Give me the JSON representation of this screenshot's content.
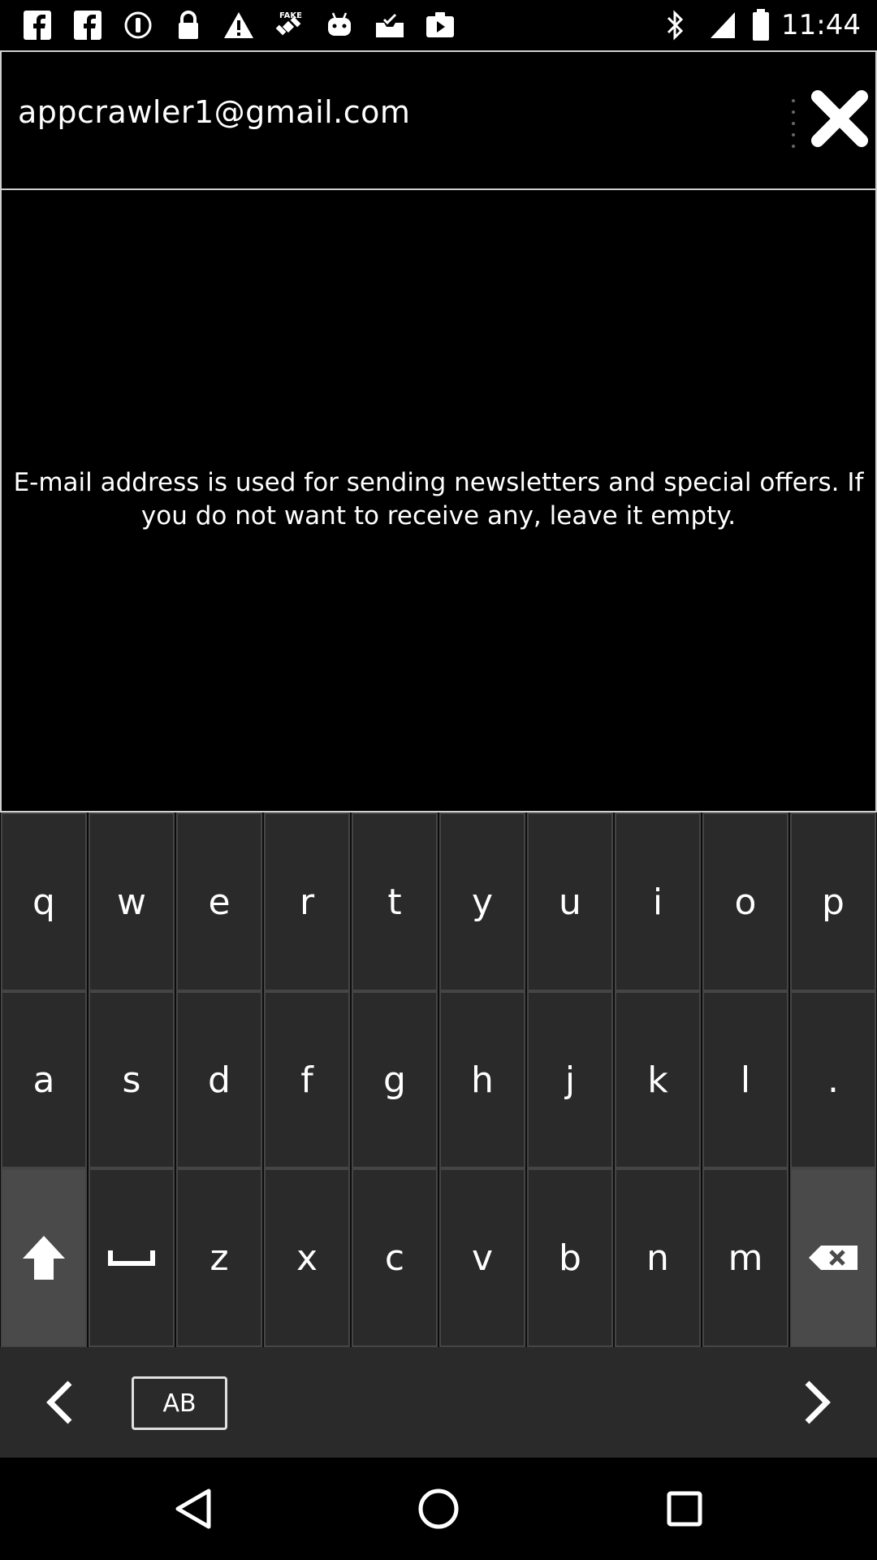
{
  "status_bar": {
    "time": "11:44",
    "left_icons": [
      "facebook-icon",
      "facebook-icon",
      "info-icon",
      "lock-icon",
      "warning-icon",
      "fake-gps-icon",
      "android-icon",
      "inbox-icon",
      "video-icon"
    ],
    "right_icons": [
      "bluetooth-icon",
      "signal-icon",
      "battery-icon"
    ]
  },
  "email": {
    "value": "appcrawler1@gmail.com"
  },
  "info": {
    "message": "E-mail address is used for sending newsletters and special offers. If you do not want to receive any, leave it empty."
  },
  "keyboard": {
    "row1": [
      "q",
      "w",
      "e",
      "r",
      "t",
      "y",
      "u",
      "i",
      "o",
      "p"
    ],
    "row2": [
      "a",
      "s",
      "d",
      "f",
      "g",
      "h",
      "j",
      "k",
      "l",
      "."
    ],
    "row3": [
      "z",
      "x",
      "c",
      "v",
      "b",
      "n",
      "m"
    ],
    "mode_label": "AB"
  },
  "colors": {
    "background": "#000000",
    "key": "#2a2a2a",
    "special_key": "#4a4a4a",
    "border": "#d0d0d0"
  }
}
